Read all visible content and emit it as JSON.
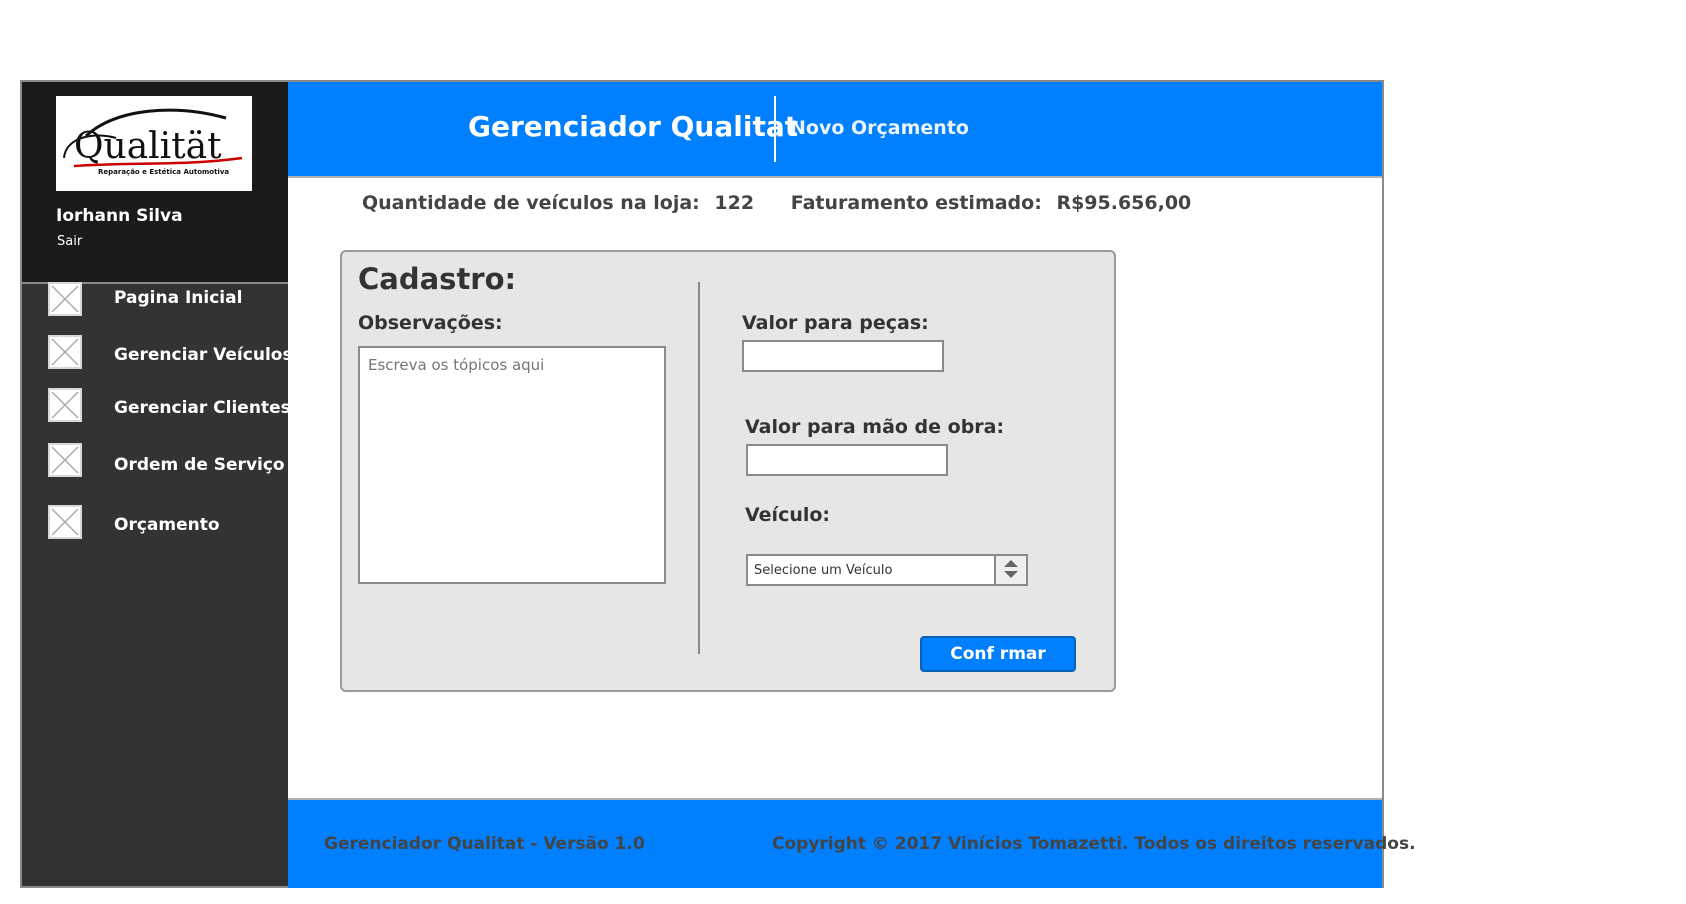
{
  "sidebar": {
    "logo_text": "Qualität",
    "logo_tagline": "Reparação e Estética Automotiva",
    "user_name": "Iorhann Silva",
    "logout_label": "Sair",
    "items": [
      {
        "label": "Pagina Inicial",
        "icon": "image-placeholder-icon"
      },
      {
        "label": "Gerenciar Veículos",
        "icon": "image-placeholder-icon"
      },
      {
        "label": "Gerenciar Clientes",
        "icon": "image-placeholder-icon"
      },
      {
        "label": "Ordem de Serviço",
        "icon": "image-placeholder-icon"
      },
      {
        "label": "Orçamento",
        "icon": "image-placeholder-icon"
      }
    ]
  },
  "header": {
    "title": "Gerenciador Qualitat",
    "subtitle": "Novo Orçamento",
    "color": "#0080ff"
  },
  "stats": {
    "vehicles_label": "Quantidade de veículos na loja:",
    "vehicles_value": "122",
    "revenue_label": "Faturamento estimado:",
    "revenue_value": "R$95.656,00"
  },
  "form": {
    "title": "Cadastro:",
    "notes_label": "Observações:",
    "notes_placeholder": "Escreva os tópicos aqui",
    "parts_label": "Valor para peças:",
    "parts_value": "",
    "labor_label": "Valor para mão de obra:",
    "labor_value": "",
    "vehicle_label": "Veículo:",
    "vehicle_select": "Selecione um Veículo",
    "confirm_label": "Conf rmar"
  },
  "footer": {
    "version": "Gerenciador Qualitat - Versão 1.0",
    "copyright": "Copyright © 2017 Vinícios Tomazetti. Todos os direitos reservados."
  }
}
